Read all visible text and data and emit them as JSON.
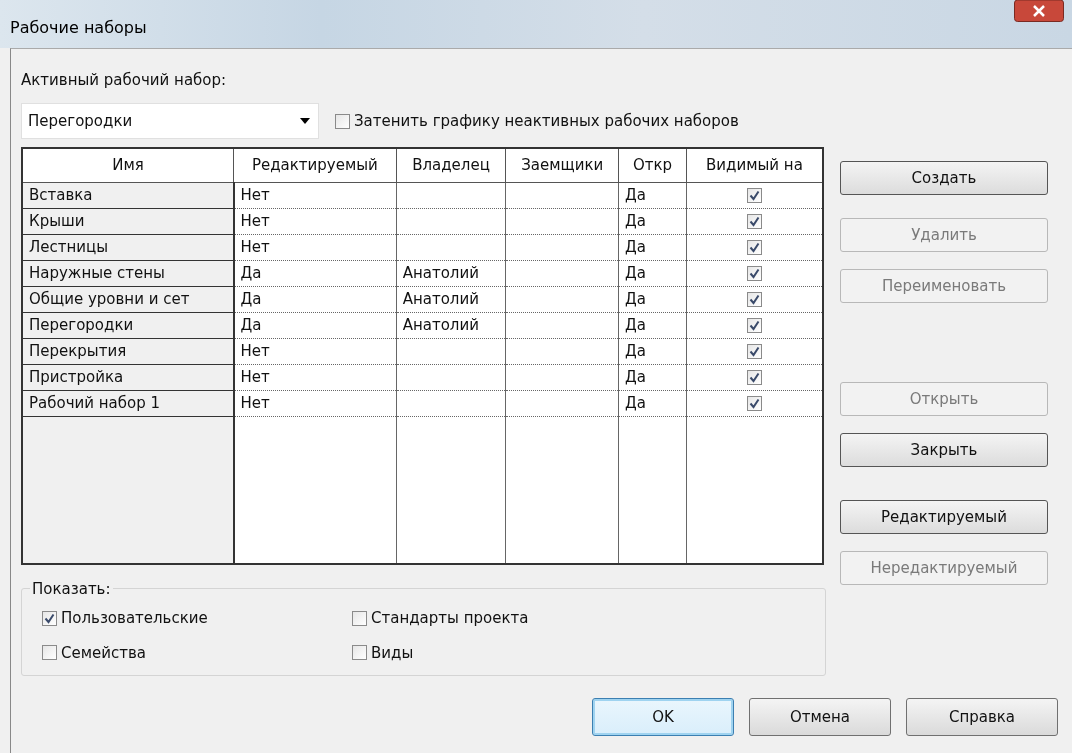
{
  "window": {
    "title": "Рабочие наборы"
  },
  "active_workset": {
    "label": "Активный рабочий набор:",
    "value": "Перегородки"
  },
  "shade_option": {
    "label": "Затенить графику неактивных рабочих наборов",
    "checked": false
  },
  "table": {
    "columns": [
      "Имя",
      "Редактируемый",
      "Владелец",
      "Заемщики",
      "Откр",
      "Видимый на"
    ],
    "rows": [
      {
        "name": "Вставка",
        "editable": "Нет",
        "owner": "",
        "open": "Да",
        "visible": true
      },
      {
        "name": "Крыши",
        "editable": "Нет",
        "owner": "",
        "open": "Да",
        "visible": true
      },
      {
        "name": "Лестницы",
        "editable": "Нет",
        "owner": "",
        "open": "Да",
        "visible": true
      },
      {
        "name": "Наружные стены",
        "editable": "Да",
        "owner": "Анатолий",
        "open": "Да",
        "visible": true
      },
      {
        "name": "Общие уровни и сет",
        "editable": "Да",
        "owner": "Анатолий",
        "open": "Да",
        "visible": true
      },
      {
        "name": "Перегородки",
        "editable": "Да",
        "owner": "Анатолий",
        "open": "Да",
        "visible": true
      },
      {
        "name": "Перекрытия",
        "editable": "Нет",
        "owner": "",
        "open": "Да",
        "visible": true
      },
      {
        "name": "Пристройка",
        "editable": "Нет",
        "owner": "",
        "open": "Да",
        "visible": true
      },
      {
        "name": "Рабочий набор 1",
        "editable": "Нет",
        "owner": "",
        "open": "Да",
        "visible": true
      }
    ]
  },
  "side_buttons": [
    {
      "label": "Создать",
      "disabled": false
    },
    {
      "label": "Удалить",
      "disabled": true
    },
    {
      "label": "Переименовать",
      "disabled": true
    },
    {
      "label": "Открыть",
      "disabled": true
    },
    {
      "label": "Закрыть",
      "disabled": false
    },
    {
      "label": "Редактируемый",
      "disabled": false
    },
    {
      "label": "Нередактируемый",
      "disabled": true
    }
  ],
  "show_group": {
    "title": "Показать:",
    "options": [
      {
        "label": "Пользовательские",
        "checked": true
      },
      {
        "label": "Стандарты проекта",
        "checked": false
      },
      {
        "label": "Семейства",
        "checked": false
      },
      {
        "label": "Виды",
        "checked": false
      }
    ]
  },
  "footer_buttons": [
    {
      "label": "OK",
      "focused": true
    },
    {
      "label": "Отмена",
      "focused": false
    },
    {
      "label": "Справка",
      "focused": false
    }
  ]
}
